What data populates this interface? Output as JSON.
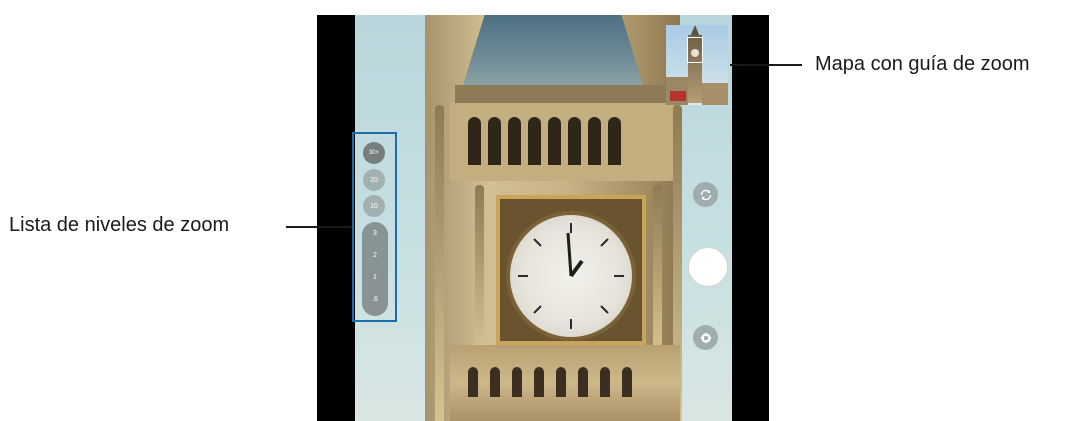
{
  "callouts": {
    "zoom_map": "Mapa con guía de zoom",
    "zoom_levels": "Lista de niveles de zoom"
  },
  "zoom_list": {
    "buttons": [
      "30×",
      "20",
      "10"
    ],
    "selected": "30×",
    "track_levels": [
      "3",
      "2",
      "1",
      ".6"
    ]
  },
  "controls": {
    "switch_camera_icon": "camera-switch-icon",
    "shutter_icon": "shutter-button",
    "effect_icon": "effects-icon"
  },
  "colors": {
    "highlight": "#1b6fa8",
    "callout_text": "#1a1a1a"
  }
}
